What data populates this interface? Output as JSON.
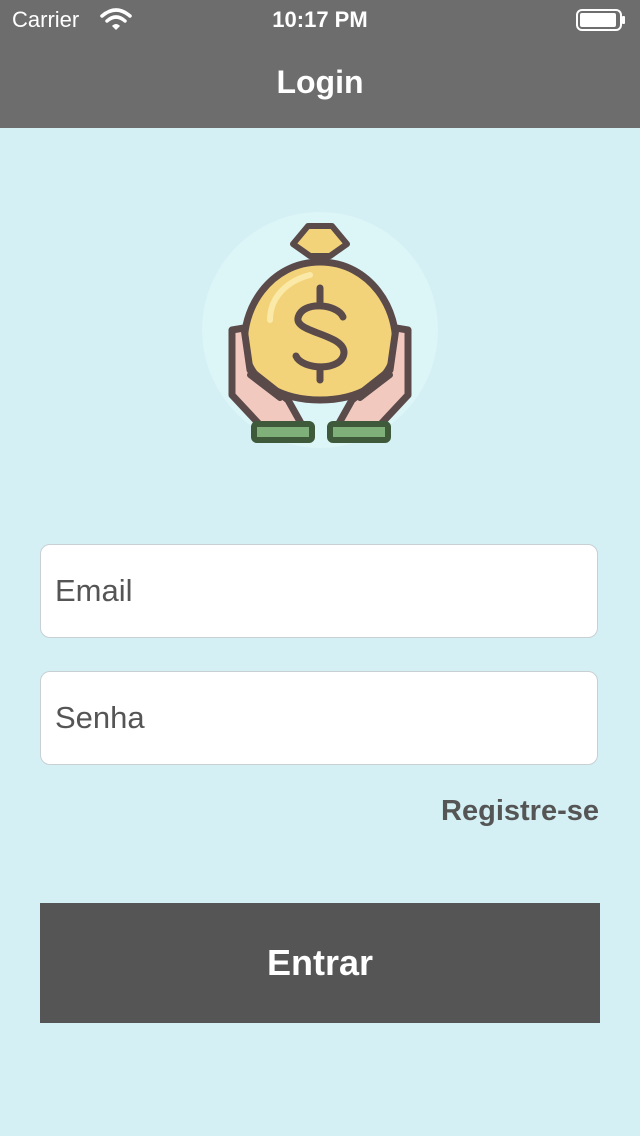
{
  "status_bar": {
    "carrier": "Carrier",
    "time": "10:17 PM",
    "wifi_icon": "wifi-icon",
    "battery_icon": "battery-icon"
  },
  "nav": {
    "title": "Login"
  },
  "logo": {
    "icon": "money-bag-in-hands-icon"
  },
  "form": {
    "email_placeholder": "Email",
    "email_value": "",
    "password_placeholder": "Senha",
    "password_value": "",
    "register_link": "Registre-se",
    "submit_label": "Entrar"
  },
  "colors": {
    "background": "#d4f0f4",
    "topbar": "#6d6d6d",
    "button": "#555555",
    "link_text": "#555555",
    "field_background": "#ffffff"
  }
}
